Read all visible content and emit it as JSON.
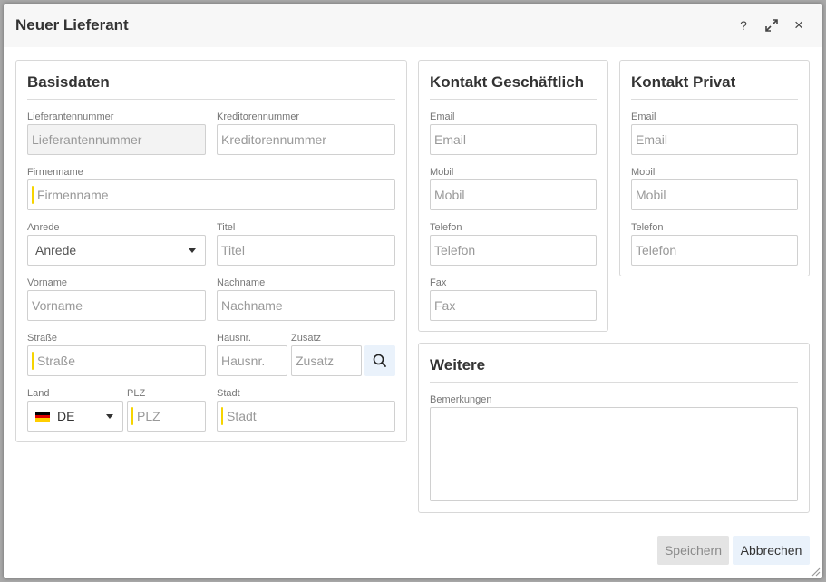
{
  "dialog": {
    "title": "Neuer Lieferant",
    "help_label": "?",
    "close_label": "×"
  },
  "basisdaten": {
    "title": "Basisdaten",
    "lieferantennummer": {
      "label": "Lieferantennummer",
      "placeholder": "Lieferantennummer",
      "value": ""
    },
    "kreditorennummer": {
      "label": "Kreditorennummer",
      "placeholder": "Kreditorennummer",
      "value": ""
    },
    "firmenname": {
      "label": "Firmenname",
      "placeholder": "Firmenname",
      "value": ""
    },
    "anrede": {
      "label": "Anrede",
      "selected": "Anrede"
    },
    "titel": {
      "label": "Titel",
      "placeholder": "Titel",
      "value": ""
    },
    "vorname": {
      "label": "Vorname",
      "placeholder": "Vorname",
      "value": ""
    },
    "nachname": {
      "label": "Nachname",
      "placeholder": "Nachname",
      "value": ""
    },
    "strasse": {
      "label": "Straße",
      "placeholder": "Straße",
      "value": ""
    },
    "hausnr": {
      "label": "Hausnr.",
      "placeholder": "Hausnr.",
      "value": ""
    },
    "zusatz": {
      "label": "Zusatz",
      "placeholder": "Zusatz",
      "value": ""
    },
    "land": {
      "label": "Land",
      "selected": "DE",
      "flag_colors": [
        "#000000",
        "#dd0000",
        "#ffce00"
      ]
    },
    "plz": {
      "label": "PLZ",
      "placeholder": "PLZ",
      "value": ""
    },
    "stadt": {
      "label": "Stadt",
      "placeholder": "Stadt",
      "value": ""
    }
  },
  "kontakt_geschaeftlich": {
    "title": "Kontakt Geschäftlich",
    "email": {
      "label": "Email",
      "placeholder": "Email"
    },
    "mobil": {
      "label": "Mobil",
      "placeholder": "Mobil"
    },
    "telefon": {
      "label": "Telefon",
      "placeholder": "Telefon"
    },
    "fax": {
      "label": "Fax",
      "placeholder": "Fax"
    }
  },
  "kontakt_privat": {
    "title": "Kontakt Privat",
    "email": {
      "label": "Email",
      "placeholder": "Email"
    },
    "mobil": {
      "label": "Mobil",
      "placeholder": "Mobil"
    },
    "telefon": {
      "label": "Telefon",
      "placeholder": "Telefon"
    }
  },
  "weitere": {
    "title": "Weitere",
    "bemerkungen": {
      "label": "Bemerkungen",
      "value": ""
    }
  },
  "footer": {
    "save_label": "Speichern",
    "cancel_label": "Abbrechen"
  },
  "colors": {
    "required_marker": "#f6d400",
    "button_primary_bg": "#eaf2fb",
    "button_disabled_bg": "#e4e4e4"
  }
}
